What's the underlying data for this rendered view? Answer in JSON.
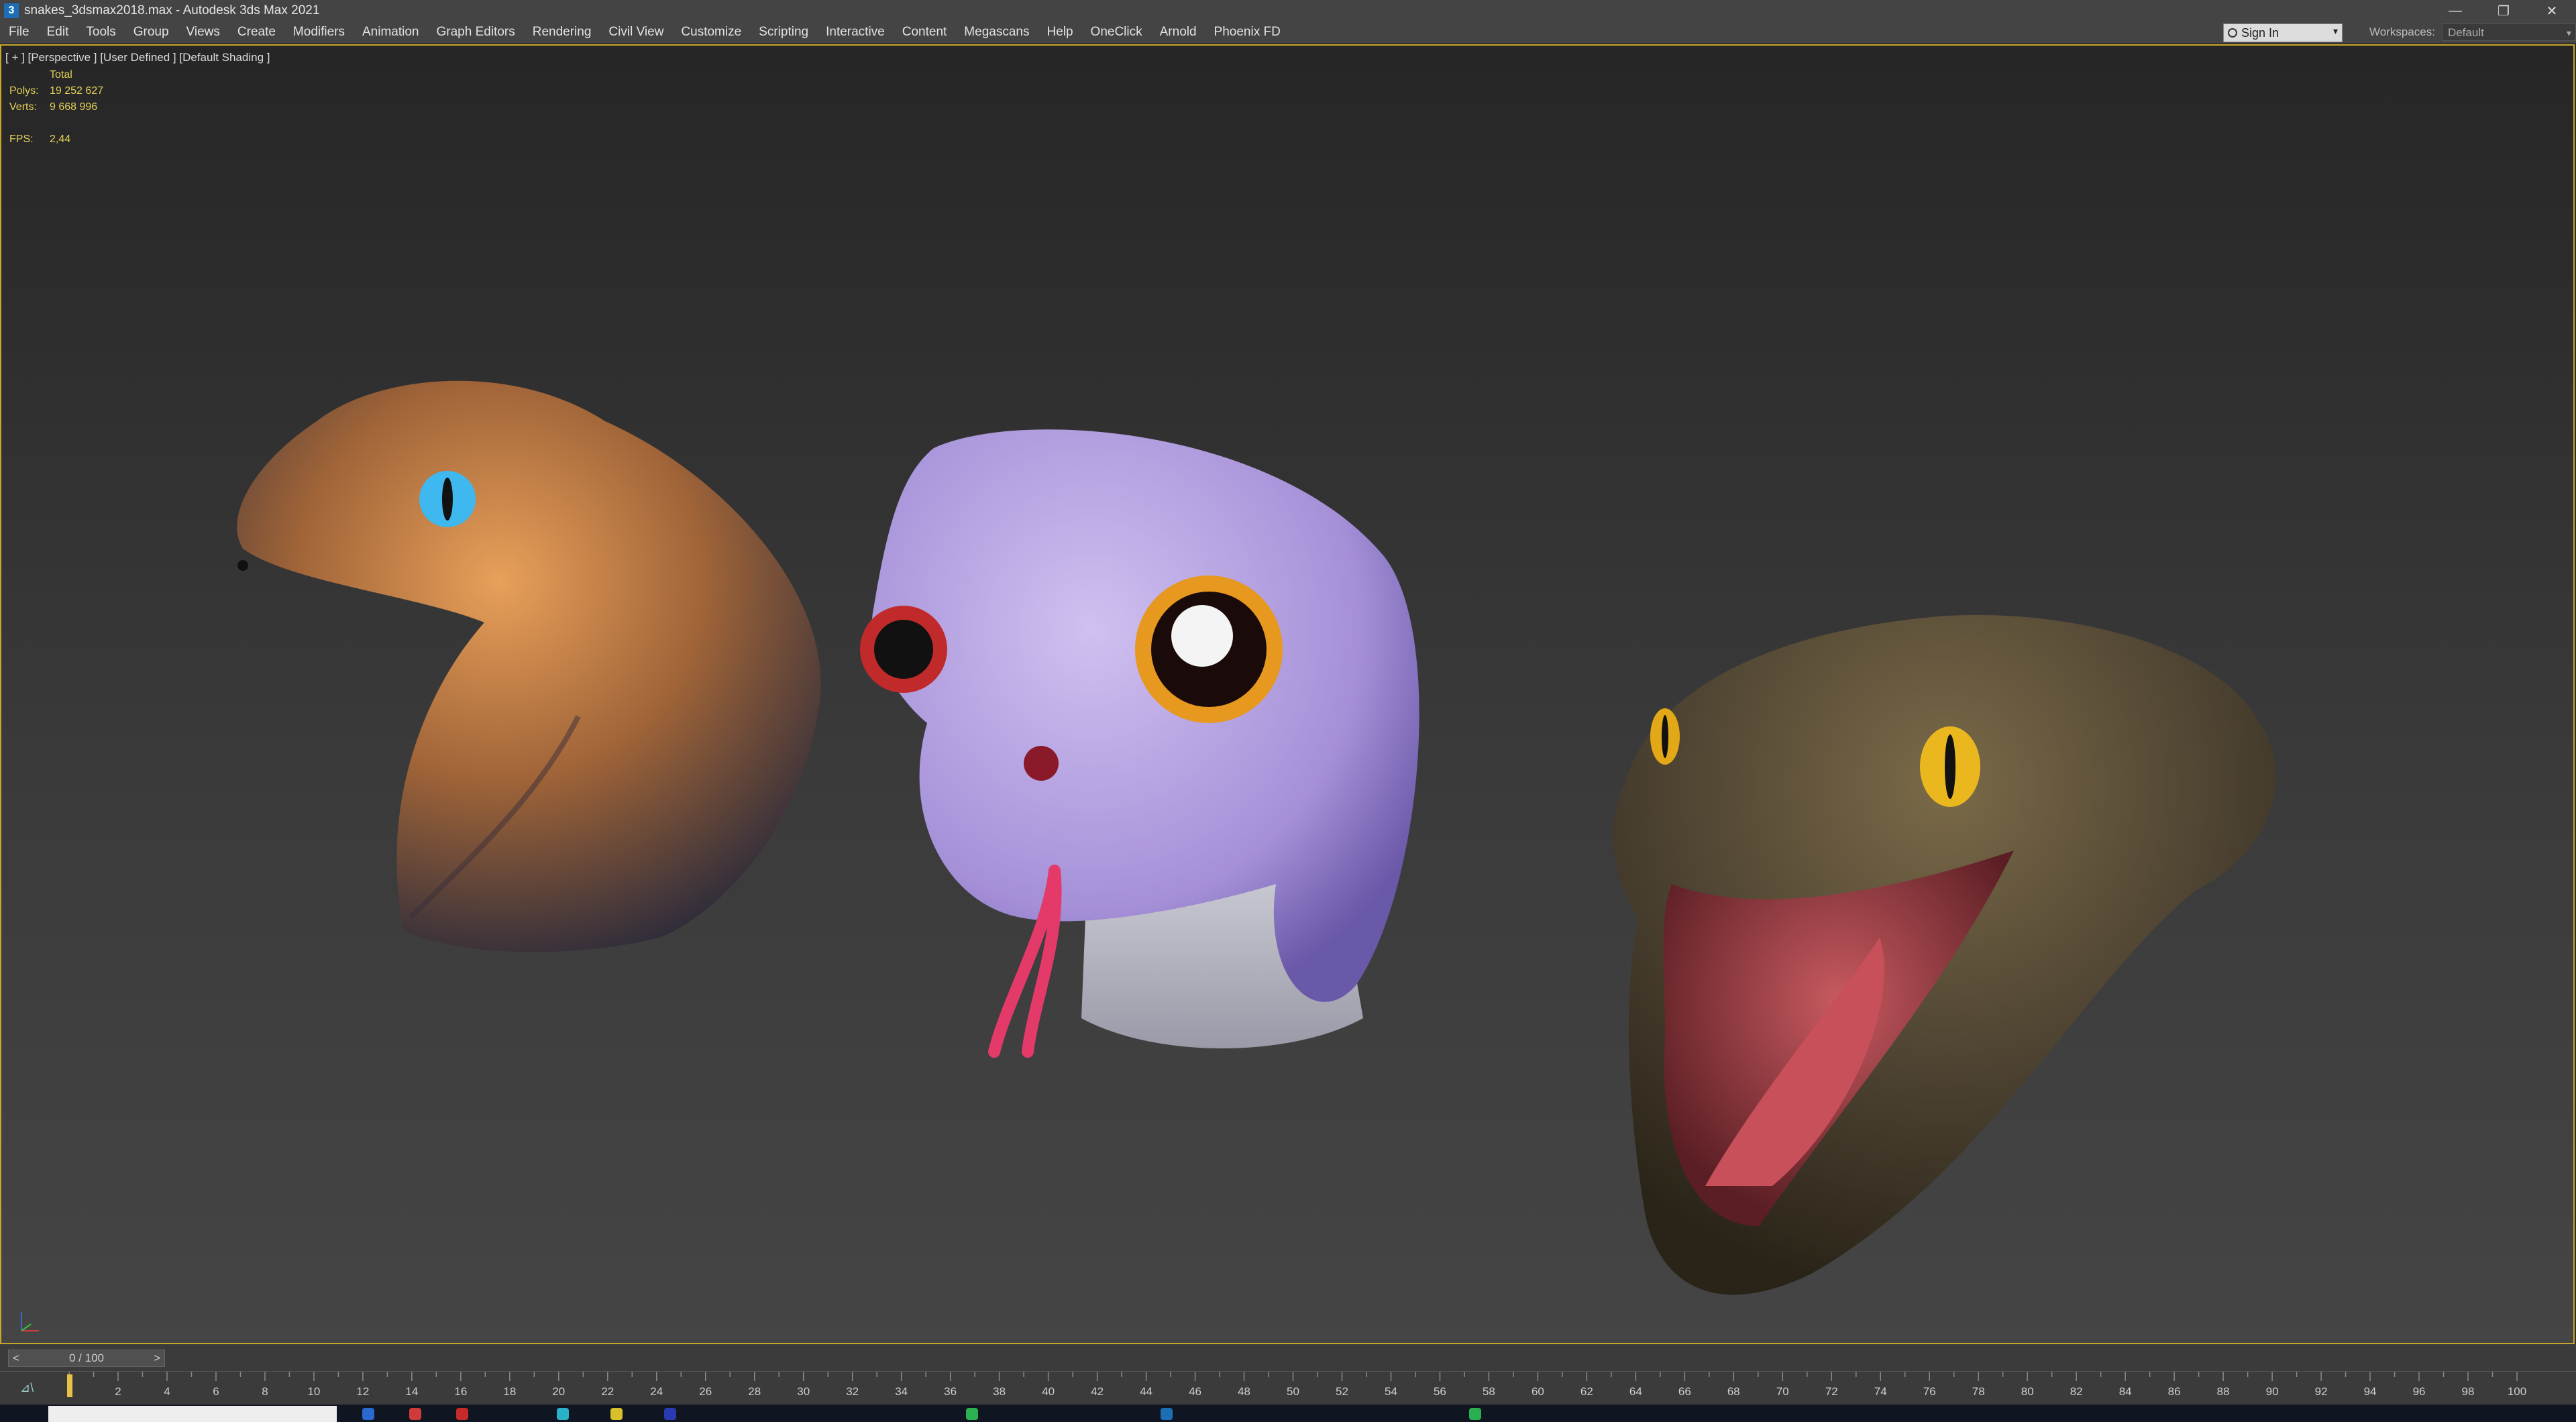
{
  "window": {
    "title": "snakes_3dsmax2018.max - Autodesk 3ds Max 2021",
    "app_icon": "3",
    "controls": {
      "minimize": "—",
      "restore": "❐",
      "close": "✕"
    }
  },
  "menu": [
    "File",
    "Edit",
    "Tools",
    "Group",
    "Views",
    "Create",
    "Modifiers",
    "Animation",
    "Graph Editors",
    "Rendering",
    "Civil View",
    "Customize",
    "Scripting",
    "Interactive",
    "Content",
    "Megascans",
    "Help",
    "OneClick",
    "Arnold",
    "Phoenix FD"
  ],
  "account": {
    "sign_in_label": "Sign In",
    "workspaces_label": "Workspaces:",
    "workspace_value": "Default"
  },
  "viewport": {
    "label": "[ + ] [Perspective ] [User Defined ] [Default Shading ]",
    "stats": {
      "header": "Total",
      "polys_label": "Polys:",
      "polys_value": "19 252 627",
      "verts_label": "Verts:",
      "verts_value": "9 668 996",
      "fps_label": "FPS:",
      "fps_value": "2,44"
    }
  },
  "timeline": {
    "slider_text": "0 / 100",
    "prev": "<",
    "next": ">",
    "ticks": [
      "2",
      "4",
      "6",
      "8",
      "10",
      "12",
      "14",
      "16",
      "18",
      "20",
      "22",
      "24",
      "26",
      "28",
      "30",
      "32",
      "34",
      "36",
      "38",
      "40",
      "42",
      "44",
      "46",
      "48",
      "50",
      "52",
      "54",
      "56",
      "58",
      "60",
      "62",
      "64",
      "66",
      "68",
      "70",
      "72",
      "74",
      "76",
      "78",
      "80",
      "82",
      "84",
      "86",
      "88",
      "90",
      "92",
      "94",
      "96",
      "98",
      "100"
    ]
  },
  "colors": {
    "viewport_border": "#c8a62a",
    "stats_text": "#e3d15a",
    "frame_marker": "#e9c146"
  }
}
